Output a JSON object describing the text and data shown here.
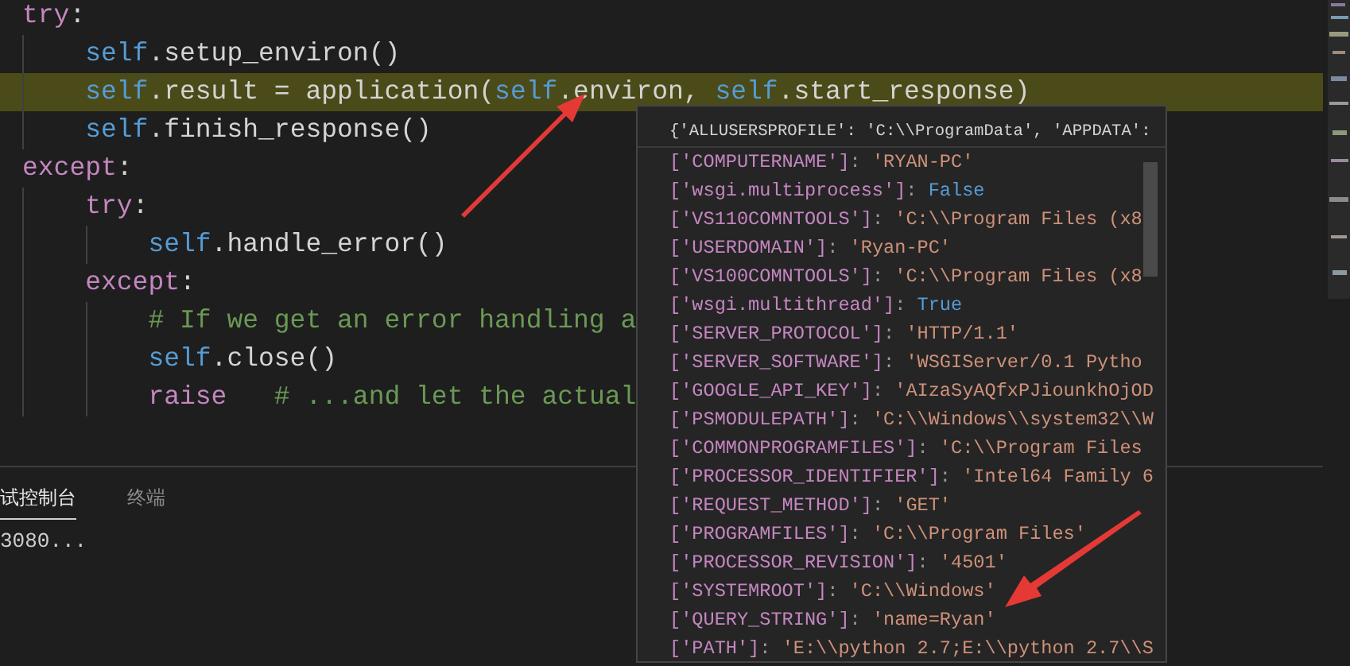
{
  "editor": {
    "lines": [
      {
        "tokens": [
          {
            "text": "try",
            "kind": "keyword"
          },
          {
            "text": ":",
            "kind": "plain"
          }
        ],
        "highlighted": false,
        "children": [
          {
            "tokens": [
              {
                "text": "self",
                "kind": "self"
              },
              {
                "text": ".setup_environ()",
                "kind": "plain"
              }
            ],
            "highlighted": false
          },
          {
            "tokens": [
              {
                "text": "self",
                "kind": "self"
              },
              {
                "text": ".result = application(",
                "kind": "plain"
              },
              {
                "text": "self",
                "kind": "self"
              },
              {
                "text": ".environ, ",
                "kind": "plain"
              },
              {
                "text": "self",
                "kind": "self"
              },
              {
                "text": ".start_response)",
                "kind": "plain"
              }
            ],
            "highlighted": true
          },
          {
            "tokens": [
              {
                "text": "self",
                "kind": "self"
              },
              {
                "text": ".finish_response()",
                "kind": "plain"
              }
            ],
            "highlighted": false
          }
        ]
      },
      {
        "tokens": [
          {
            "text": "except",
            "kind": "keyword"
          },
          {
            "text": ":",
            "kind": "plain"
          }
        ],
        "highlighted": false,
        "children": [
          {
            "tokens": [
              {
                "text": "try",
                "kind": "keyword"
              },
              {
                "text": ":",
                "kind": "plain"
              }
            ],
            "highlighted": false,
            "children": [
              {
                "tokens": [
                  {
                    "text": "self",
                    "kind": "self"
                  },
                  {
                    "text": ".handle_error()",
                    "kind": "plain"
                  }
                ],
                "highlighted": false
              }
            ]
          },
          {
            "tokens": [
              {
                "text": "except",
                "kind": "keyword"
              },
              {
                "text": ":",
                "kind": "plain"
              }
            ],
            "highlighted": false,
            "children": [
              {
                "tokens": [
                  {
                    "text": "# If we get an error handling a",
                    "kind": "comment"
                  }
                ],
                "highlighted": false
              },
              {
                "tokens": [
                  {
                    "text": "self",
                    "kind": "self"
                  },
                  {
                    "text": ".close()",
                    "kind": "plain"
                  }
                ],
                "highlighted": false
              },
              {
                "tokens": [
                  {
                    "text": "raise",
                    "kind": "keyword"
                  },
                  {
                    "text": "   # ...and let the actual",
                    "kind": "comment"
                  }
                ],
                "highlighted": false
              }
            ]
          }
        ]
      }
    ]
  },
  "hover": {
    "header": "{'ALLUSERSPROFILE': 'C:\\\\ProgramData', 'APPDATA':",
    "rows": [
      {
        "key": "['COMPUTERNAME']",
        "sep": ": ",
        "value": "'RYAN-PC'",
        "kind": "string"
      },
      {
        "key": "['wsgi.multiprocess']",
        "sep": ": ",
        "value": "False",
        "kind": "bool"
      },
      {
        "key": "['VS110COMNTOOLS']",
        "sep": ": ",
        "value": "'C:\\\\Program Files (x8",
        "kind": "string"
      },
      {
        "key": "['USERDOMAIN']",
        "sep": ": ",
        "value": "'Ryan-PC'",
        "kind": "string"
      },
      {
        "key": "['VS100COMNTOOLS']",
        "sep": ": ",
        "value": "'C:\\\\Program Files (x8",
        "kind": "string"
      },
      {
        "key": "['wsgi.multithread']",
        "sep": ": ",
        "value": "True",
        "kind": "bool"
      },
      {
        "key": "['SERVER_PROTOCOL']",
        "sep": ": ",
        "value": "'HTTP/1.1'",
        "kind": "string"
      },
      {
        "key": "['SERVER_SOFTWARE']",
        "sep": ": ",
        "value": "'WSGIServer/0.1 Pytho",
        "kind": "string"
      },
      {
        "key": "['GOOGLE_API_KEY']",
        "sep": ": ",
        "value": "'AIzaSyAQfxPJiounkhOjOD",
        "kind": "string"
      },
      {
        "key": "['PSMODULEPATH']",
        "sep": ": ",
        "value": "'C:\\\\Windows\\\\system32\\\\W",
        "kind": "string"
      },
      {
        "key": "['COMMONPROGRAMFILES']",
        "sep": ": ",
        "value": "'C:\\\\Program Files",
        "kind": "string"
      },
      {
        "key": "['PROCESSOR_IDENTIFIER']",
        "sep": ": ",
        "value": "'Intel64 Family 6",
        "kind": "string"
      },
      {
        "key": "['REQUEST_METHOD']",
        "sep": ": ",
        "value": "'GET'",
        "kind": "string"
      },
      {
        "key": "['PROGRAMFILES']",
        "sep": ": ",
        "value": "'C:\\\\Program Files'",
        "kind": "string"
      },
      {
        "key": "['PROCESSOR_REVISION']",
        "sep": ": ",
        "value": "'4501'",
        "kind": "string"
      },
      {
        "key": "['SYSTEMROOT']",
        "sep": ": ",
        "value": "'C:\\\\Windows'",
        "kind": "string"
      },
      {
        "key": "['QUERY_STRING']",
        "sep": ": ",
        "value": "'name=Ryan'",
        "kind": "string"
      },
      {
        "key": "['PATH']",
        "sep": ": ",
        "value": "'E:\\\\python 2.7;E:\\\\python 2.7\\\\S",
        "kind": "string"
      }
    ]
  },
  "panel": {
    "tabs": [
      {
        "label": "试控制台",
        "selected": true
      },
      {
        "label": "终端",
        "selected": false
      }
    ],
    "output": "3080..."
  }
}
